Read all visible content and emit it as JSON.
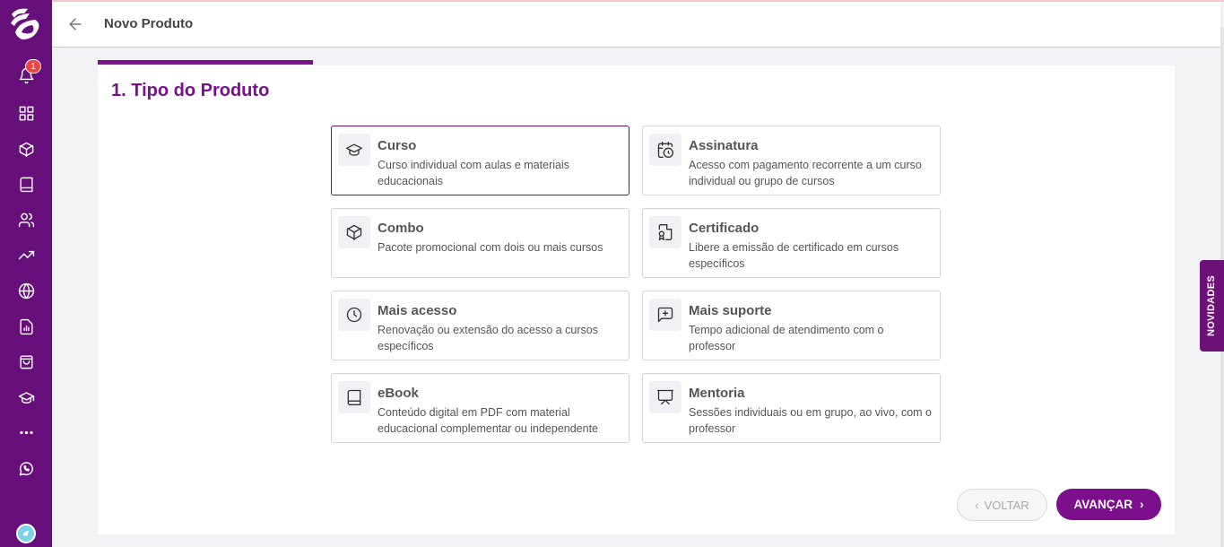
{
  "sidebar": {
    "notification_badge": "1",
    "items": [
      "bell-icon",
      "dashboard-icon",
      "box-icon",
      "book-icon",
      "users-icon",
      "trending-icon",
      "globe-icon",
      "report-icon",
      "bag-icon",
      "graduation-icon",
      "more-icon",
      "whatsapp-icon"
    ]
  },
  "header": {
    "title": "Novo Produto"
  },
  "step": {
    "title": "1. Tipo do Produto"
  },
  "options": [
    {
      "title": "Curso",
      "desc": "Curso individual com aulas e materiais educacionais",
      "icon": "graduation-cap-icon",
      "selected": true
    },
    {
      "title": "Assinatura",
      "desc": "Acesso com pagamento recorrente a um curso individual ou grupo de cursos",
      "icon": "calendar-clock-icon"
    },
    {
      "title": "Combo",
      "desc": "Pacote promocional com dois ou mais cursos",
      "icon": "package-icon"
    },
    {
      "title": "Certificado",
      "desc": "Libere a emissão de certificado em cursos específicos",
      "icon": "certificate-icon"
    },
    {
      "title": "Mais acesso",
      "desc": "Renovação ou extensão do acesso a cursos específicos",
      "icon": "clock-icon"
    },
    {
      "title": "Mais suporte",
      "desc": "Tempo adicional de atendimento com o professor",
      "icon": "message-plus-icon"
    },
    {
      "title": "eBook",
      "desc": "Conteúdo digital em PDF com material educacional complementar ou independente",
      "icon": "ebook-icon"
    },
    {
      "title": "Mentoria",
      "desc": "Sessões individuais ou em grupo, ao vivo, com o professor",
      "icon": "presentation-icon"
    }
  ],
  "buttons": {
    "back": "VOLTAR",
    "next": "AVANÇAR"
  },
  "news_tab": "NOVIDADES",
  "colors": {
    "brand": "#7b0f8c",
    "sidebar": "#660f7a",
    "badge": "#ef4444"
  }
}
